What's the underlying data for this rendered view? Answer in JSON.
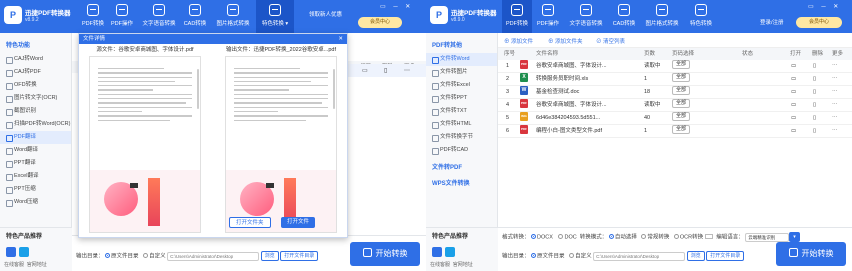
{
  "app": {
    "name": "迅捷PDF转换器",
    "version": "v8.9.2"
  },
  "app2": {
    "name": "迅捷PDF转换器",
    "version": "v8.9.0"
  },
  "tabs": [
    {
      "label": "PDF转换"
    },
    {
      "label": "PDF操作"
    },
    {
      "label": "文字语音转换"
    },
    {
      "label": "CAD转换"
    },
    {
      "label": "图片格式转换"
    },
    {
      "label": "特色转换"
    }
  ],
  "header_right": {
    "promo": "领取新人优惠",
    "vip": "会员中心",
    "login": "登录/注册"
  },
  "window_controls": "▭ ─ ✕",
  "sidebar1": {
    "heading": "特色功能",
    "items": [
      "CAJ转Word",
      "CAJ转PDF",
      "OFD转换",
      "图片转文字(OCR)",
      "截图识别",
      "扫描PDF转Word(OCR)",
      "PDF翻译",
      "Word翻译",
      "PPT翻译",
      "Excel翻译",
      "PPT压缩",
      "Word压缩"
    ],
    "selected_index": 6,
    "products": "特色产品推荐",
    "links": [
      "在线客服",
      "官网地址"
    ]
  },
  "modal": {
    "title": "文件详情",
    "left_title": "源文件：谷歌安卓商城图、字体设计.pdf",
    "right_title": "输出文件：迅捷PDF转换_2022谷歌安卓...pdf",
    "btn_open_folder": "打开文件夹",
    "btn_open_file": "打开文件"
  },
  "w1_cols": [
    "打开",
    "删除",
    "更多"
  ],
  "w1_bottom": {
    "label": "输出目录：",
    "opt1": "原文件目录",
    "opt2": "自定义",
    "path": "C:\\Users\\Administrator\\Desktop",
    "browse": "浏览",
    "open": "打开文件目录",
    "start": "开始转换"
  },
  "sidebar2": {
    "heading": "PDF转其他",
    "items": [
      "文件转Word",
      "文件转图片",
      "文件转Excel",
      "文件转PPT",
      "文件转TXT",
      "文件转HTML",
      "文件转换字节",
      "PDF转CAD"
    ],
    "selected_index": 0,
    "sections": [
      "文件转PDF",
      "WPS文件转换"
    ],
    "products": "特色产品推荐",
    "links": [
      "在线客服",
      "官网地址"
    ]
  },
  "w2_toolbar": {
    "add_file": "添加文件",
    "add_folder": "添加文件夹",
    "clear": "清空列表"
  },
  "table": {
    "headers": [
      "序号",
      "文件名称",
      "页数",
      "页码选择",
      "状态",
      "打开",
      "删除",
      "更多"
    ],
    "rows": [
      {
        "no": "1",
        "name": "谷歌安卓商城图、字体设计...",
        "type": "PDF",
        "color": "#d9363e",
        "pages": "读取中",
        "range": "全部"
      },
      {
        "no": "2",
        "name": "转换服务员职时间.xls",
        "type": "X",
        "color": "#1f8f4e",
        "pages": "1",
        "range": "全部"
      },
      {
        "no": "3",
        "name": "基金检查测试.doc",
        "type": "W",
        "color": "#2b5fc1",
        "pages": "18",
        "range": "全部"
      },
      {
        "no": "4",
        "name": "谷歌安卓商城图、字体设计...",
        "type": "PDF",
        "color": "#d9363e",
        "pages": "读取中",
        "range": "全部"
      },
      {
        "no": "5",
        "name": "6d46e384204593.5d551...",
        "type": "IMG",
        "color": "#e8a020",
        "pages": "40",
        "range": "全部"
      },
      {
        "no": "6",
        "name": "编程小白-图文类型文件.pdf",
        "type": "PDF",
        "color": "#d9363e",
        "pages": "1",
        "range": "全部"
      }
    ]
  },
  "w2_options": {
    "format_label": "格式转换：",
    "fmt1": "DOCX",
    "fmt2": "DOC",
    "mode_label": "转换模式：",
    "mode1": "自动选择",
    "mode2": "常规转换",
    "mode3": "OCR转换",
    "lang_label": "编辑语言：",
    "lang_value": "云端精准识别"
  },
  "w2_bottom": {
    "label": "输出目录：",
    "opt1": "原文件目录",
    "opt2": "自定义",
    "path": "C:\\Users\\Administrator\\Desktop",
    "browse": "浏览",
    "open": "打开文件目录",
    "start": "开始转换"
  }
}
